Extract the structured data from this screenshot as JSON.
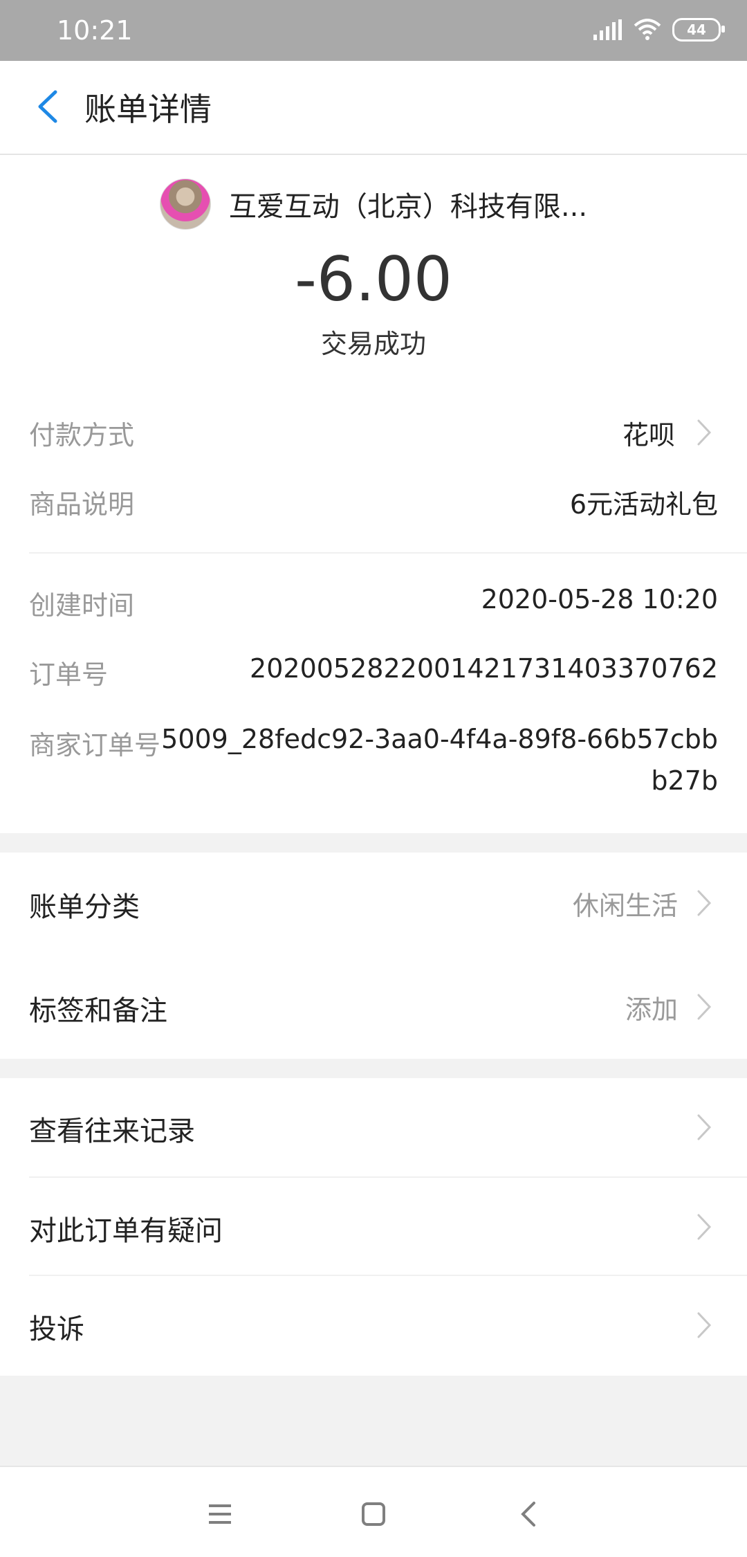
{
  "status_bar": {
    "time": "10:21",
    "battery": "44",
    "icons": [
      "signal-icon",
      "wifi-icon",
      "battery-icon"
    ]
  },
  "header": {
    "title": "账单详情",
    "back_icon": "chevron-left-icon"
  },
  "merchant": {
    "name": "互爱互动（北京）科技有限...",
    "avatar": "pug-avatar"
  },
  "transaction": {
    "amount": "-6.00",
    "status": "交易成功"
  },
  "details": [
    {
      "label": "付款方式",
      "value": "花呗"
    },
    {
      "label": "商品说明",
      "value": "6元活动礼包"
    },
    {
      "label": "创建时间",
      "value": "2020-05-28 10:20"
    },
    {
      "label": "订单号",
      "value": "2020052822001421731403370762"
    },
    {
      "label": "商家订单号",
      "value_line1": "5009_28fedc92-3aa0-4f4a-89f8-66b57cbb",
      "value_line2": "b27b"
    }
  ],
  "category": {
    "label": "账单分类",
    "value": "休闲生活"
  },
  "tags": {
    "label": "标签和备注",
    "value": "添加"
  },
  "actions": [
    {
      "label": "查看往来记录"
    },
    {
      "label": "对此订单有疑问"
    },
    {
      "label": "投诉"
    }
  ],
  "colors": {
    "accent": "#1e88e5",
    "status_bar": "#a9a9a9"
  },
  "system_nav": {
    "icons": [
      "menu-icon",
      "home-icon",
      "back-icon"
    ]
  }
}
